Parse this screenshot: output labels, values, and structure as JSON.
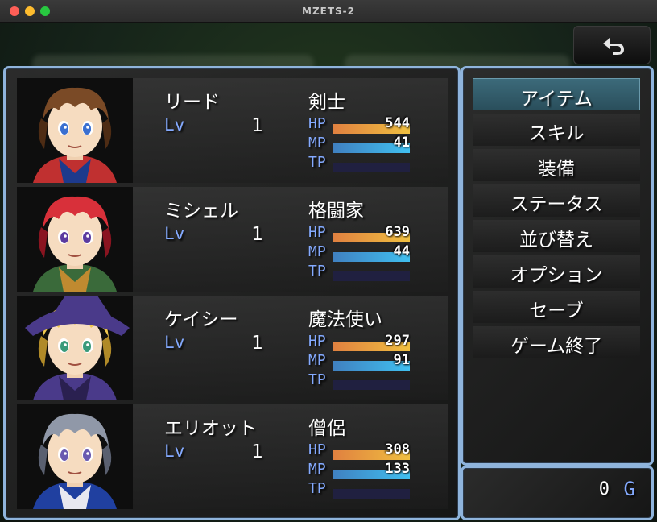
{
  "window": {
    "title": "MZETS-2"
  },
  "actors": [
    {
      "name": "リード",
      "lv_label": "Lv",
      "level": "1",
      "class": "剣士",
      "hp_label": "HP",
      "hp": "544",
      "hp_rate": 1.0,
      "mp_label": "MP",
      "mp": "41",
      "mp_rate": 1.0,
      "tp_label": "TP",
      "tp_rate": 0.0
    },
    {
      "name": "ミシェル",
      "lv_label": "Lv",
      "level": "1",
      "class": "格闘家",
      "hp_label": "HP",
      "hp": "639",
      "hp_rate": 1.0,
      "mp_label": "MP",
      "mp": "44",
      "mp_rate": 1.0,
      "tp_label": "TP",
      "tp_rate": 0.0
    },
    {
      "name": "ケイシー",
      "lv_label": "Lv",
      "level": "1",
      "class": "魔法使い",
      "hp_label": "HP",
      "hp": "297",
      "hp_rate": 1.0,
      "mp_label": "MP",
      "mp": "91",
      "mp_rate": 1.0,
      "tp_label": "TP",
      "tp_rate": 0.0
    },
    {
      "name": "エリオット",
      "lv_label": "Lv",
      "level": "1",
      "class": "僧侶",
      "hp_label": "HP",
      "hp": "308",
      "hp_rate": 1.0,
      "mp_label": "MP",
      "mp": "133",
      "mp_rate": 1.0,
      "tp_label": "TP",
      "tp_rate": 0.0
    }
  ],
  "commands": [
    {
      "label": "アイテム",
      "selected": true
    },
    {
      "label": "スキル",
      "selected": false
    },
    {
      "label": "装備",
      "selected": false
    },
    {
      "label": "ステータス",
      "selected": false
    },
    {
      "label": "並び替え",
      "selected": false
    },
    {
      "label": "オプション",
      "selected": false
    },
    {
      "label": "セーブ",
      "selected": false
    },
    {
      "label": "ゲーム終了",
      "selected": false
    }
  ],
  "gold": {
    "value": "0",
    "unit": "G"
  },
  "icons": {
    "back": "back-arrow-icon"
  },
  "colors": {
    "system_blue": "#84aaff",
    "window_border": "#8fb4dc",
    "hp": "#e08040",
    "mp": "#40a0e0"
  }
}
